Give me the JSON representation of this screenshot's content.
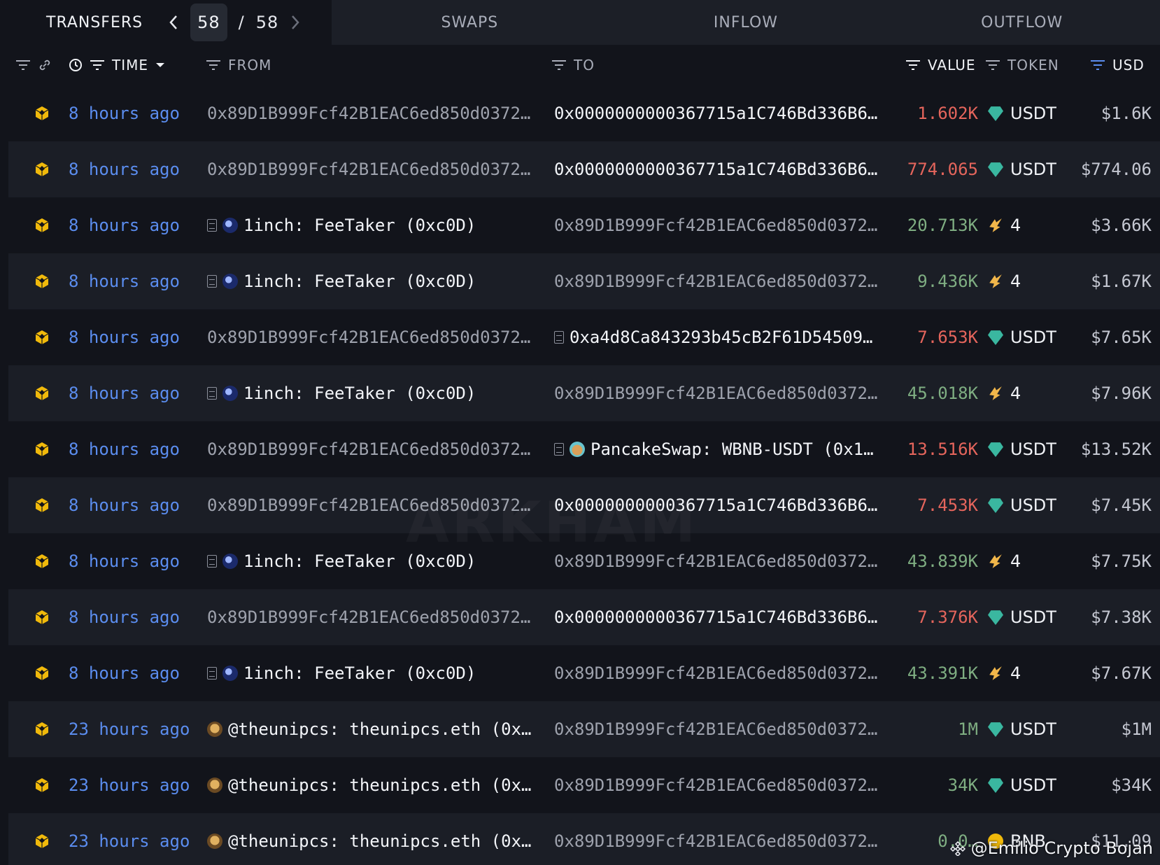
{
  "tabs": {
    "active": "TRANSFERS",
    "page_current": "58",
    "page_sep": "/",
    "page_total": "58",
    "others": [
      "SWAPS",
      "INFLOW",
      "OUTFLOW"
    ]
  },
  "columns": {
    "time": "TIME",
    "from": "FROM",
    "to": "TO",
    "value": "VALUE",
    "token": "TOKEN",
    "usd": "USD"
  },
  "rows": [
    {
      "time": "8 hours ago",
      "from": "0x89D1B999Fcf42B1EAC6ed850d0372…",
      "from_kind": "address",
      "to": "0x0000000000367715a1C746Bd336B6…",
      "to_kind": "address-bright",
      "value": "1.602K",
      "dir": "neg",
      "token": "USDT",
      "token_icon": "usdt-icon",
      "usd": "$1.6K"
    },
    {
      "time": "8 hours ago",
      "from": "0x89D1B999Fcf42B1EAC6ed850d0372…",
      "from_kind": "address",
      "to": "0x0000000000367715a1C746Bd336B6…",
      "to_kind": "address-bright",
      "value": "774.065",
      "dir": "neg",
      "token": "USDT",
      "token_icon": "usdt-icon",
      "usd": "$774.06"
    },
    {
      "time": "8 hours ago",
      "from": "1inch: FeeTaker (0xc0D)",
      "from_kind": "1inch",
      "to": "0x89D1B999Fcf42B1EAC6ed850d0372…",
      "to_kind": "address",
      "value": "20.713K",
      "dir": "pos",
      "token": "4",
      "token_icon": "four-token-icon",
      "usd": "$3.66K"
    },
    {
      "time": "8 hours ago",
      "from": "1inch: FeeTaker (0xc0D)",
      "from_kind": "1inch",
      "to": "0x89D1B999Fcf42B1EAC6ed850d0372…",
      "to_kind": "address",
      "value": "9.436K",
      "dir": "pos",
      "token": "4",
      "token_icon": "four-token-icon",
      "usd": "$1.67K"
    },
    {
      "time": "8 hours ago",
      "from": "0x89D1B999Fcf42B1EAC6ed850d0372…",
      "from_kind": "address",
      "to": "0xa4d8Ca843293b45cB2F61D54509…",
      "to_kind": "contract",
      "value": "7.653K",
      "dir": "neg",
      "token": "USDT",
      "token_icon": "usdt-icon",
      "usd": "$7.65K"
    },
    {
      "time": "8 hours ago",
      "from": "1inch: FeeTaker (0xc0D)",
      "from_kind": "1inch",
      "to": "0x89D1B999Fcf42B1EAC6ed850d0372…",
      "to_kind": "address",
      "value": "45.018K",
      "dir": "pos",
      "token": "4",
      "token_icon": "four-token-icon",
      "usd": "$7.96K"
    },
    {
      "time": "8 hours ago",
      "from": "0x89D1B999Fcf42B1EAC6ed850d0372…",
      "from_kind": "address",
      "to": "PancakeSwap: WBNB-USDT (0x1…",
      "to_kind": "pancake",
      "value": "13.516K",
      "dir": "neg",
      "token": "USDT",
      "token_icon": "usdt-icon",
      "usd": "$13.52K"
    },
    {
      "time": "8 hours ago",
      "from": "0x89D1B999Fcf42B1EAC6ed850d0372…",
      "from_kind": "address",
      "to": "0x0000000000367715a1C746Bd336B6…",
      "to_kind": "address-bright",
      "value": "7.453K",
      "dir": "neg",
      "token": "USDT",
      "token_icon": "usdt-icon",
      "usd": "$7.45K"
    },
    {
      "time": "8 hours ago",
      "from": "1inch: FeeTaker (0xc0D)",
      "from_kind": "1inch",
      "to": "0x89D1B999Fcf42B1EAC6ed850d0372…",
      "to_kind": "address",
      "value": "43.839K",
      "dir": "pos",
      "token": "4",
      "token_icon": "four-token-icon",
      "usd": "$7.75K"
    },
    {
      "time": "8 hours ago",
      "from": "0x89D1B999Fcf42B1EAC6ed850d0372…",
      "from_kind": "address",
      "to": "0x0000000000367715a1C746Bd336B6…",
      "to_kind": "address-bright",
      "value": "7.376K",
      "dir": "neg",
      "token": "USDT",
      "token_icon": "usdt-icon",
      "usd": "$7.38K"
    },
    {
      "time": "8 hours ago",
      "from": "1inch: FeeTaker (0xc0D)",
      "from_kind": "1inch",
      "to": "0x89D1B999Fcf42B1EAC6ed850d0372…",
      "to_kind": "address",
      "value": "43.391K",
      "dir": "pos",
      "token": "4",
      "token_icon": "four-token-icon",
      "usd": "$7.67K"
    },
    {
      "time": "23 hours ago",
      "from": "@theunipcs: theunipcs.eth (0x…",
      "from_kind": "theunipcs",
      "to": "0x89D1B999Fcf42B1EAC6ed850d0372…",
      "to_kind": "address",
      "value": "1M",
      "dir": "pos",
      "token": "USDT",
      "token_icon": "usdt-icon",
      "usd": "$1M"
    },
    {
      "time": "23 hours ago",
      "from": "@theunipcs: theunipcs.eth (0x…",
      "from_kind": "theunipcs",
      "to": "0x89D1B999Fcf42B1EAC6ed850d0372…",
      "to_kind": "address",
      "value": "34K",
      "dir": "pos",
      "token": "USDT",
      "token_icon": "usdt-icon",
      "usd": "$34K"
    },
    {
      "time": "23 hours ago",
      "from": "@theunipcs: theunipcs.eth (0x…",
      "from_kind": "theunipcs",
      "to": "0x89D1B999Fcf42B1EAC6ed850d0372…",
      "to_kind": "address",
      "value": "0.0…",
      "dir": "pos",
      "token": "BNB",
      "token_icon": "bnb-icon",
      "usd": "$11.09"
    }
  ],
  "watermark": "ARKHAM",
  "credit": "@Emilio Crypto Bojan",
  "colors": {
    "background": "#12141b",
    "row_alt": "#1b1e26",
    "time_link": "#5b8def",
    "negative": "#e5655c",
    "positive": "#7fae82",
    "chain_icon": "#f0b90b"
  }
}
